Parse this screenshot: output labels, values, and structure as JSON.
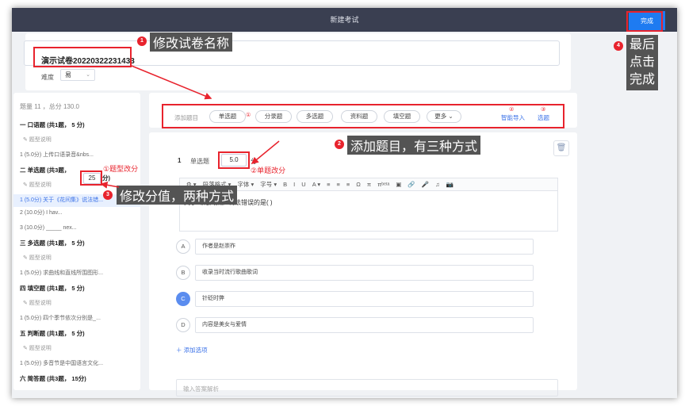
{
  "header": {
    "title": "新建考试",
    "done_label": "完成"
  },
  "paper": {
    "title": "演示试卷20220322231433",
    "difficulty_label": "难度",
    "difficulty_value": "易"
  },
  "sidebar": {
    "summary": "题量 11 ，总分 130.0",
    "rows": [
      {
        "type": "sec",
        "text": "一 口语题 (共1题，  5 分)"
      },
      {
        "type": "desc",
        "text": "✎ 题型说明"
      },
      {
        "type": "q",
        "text": "1 (5.0分) 上传口语录音&nbs..."
      },
      {
        "type": "sec",
        "text": "二 单选题 (共3题，"
      },
      {
        "type": "desc",
        "text": "✎ 题型说明"
      },
      {
        "type": "qa",
        "text": "1 (5.0分) 关于《花间集》说法错..."
      },
      {
        "type": "q",
        "text": "2 (10.0分) I hav..."
      },
      {
        "type": "q",
        "text": "3 (10.0分) _____ nex..."
      },
      {
        "type": "sec",
        "text": "三 多选题 (共1题，  5 分)"
      },
      {
        "type": "desc",
        "text": "✎ 题型说明"
      },
      {
        "type": "q",
        "text": "1 (5.0分) 求曲线和直线所围图形..."
      },
      {
        "type": "sec",
        "text": "四 填空题 (共1题，  5 分)"
      },
      {
        "type": "desc",
        "text": "✎ 题型说明"
      },
      {
        "type": "q",
        "text": "1 (5.0分) 四个季节依次分别是_..."
      },
      {
        "type": "sec",
        "text": "五 判断题 (共1题，  5 分)"
      },
      {
        "type": "desc",
        "text": "✎ 题型说明"
      },
      {
        "type": "q",
        "text": "1 (5.0分) 多音节是中国语言文化..."
      },
      {
        "type": "sec",
        "text": "六 简答题 (共3题， 15分)"
      }
    ],
    "section_score": "25",
    "section_suffix": "分)"
  },
  "addbar": {
    "label": "添加题目",
    "pills": [
      "单选题",
      "分录题",
      "多选题",
      "资料题",
      "填空题",
      "更多"
    ],
    "smart_import": "智能导入",
    "pick_question": "选题",
    "num1": "①",
    "num2": "②",
    "num3": "③"
  },
  "question": {
    "index": "1",
    "type": "单选题",
    "score": "5.0",
    "score_unit": "分",
    "toolbar": [
      "段落格式 ▾",
      "字体 ▾",
      "字号 ▾",
      "B",
      "I",
      "U",
      "A ▾",
      "≡",
      "≡",
      "≡",
      "Ω",
      "π",
      "πᵇᵉᵗᵃ",
      "▣",
      "🔗",
      "🎤",
      "♫",
      "📷"
    ],
    "stem": "关于《花间集》说法错误的是(    )",
    "options": [
      {
        "letter": "A",
        "text": "作者是赵崇祚"
      },
      {
        "letter": "B",
        "text": "收录当时流行歌曲歌词"
      },
      {
        "letter": "C",
        "text": "针砭时弊"
      },
      {
        "letter": "D",
        "text": "内容是美女与爱情"
      }
    ],
    "add_option": "添加选项",
    "analysis_placeholder": "输入答案解析"
  },
  "annotations": {
    "a1": "修改试卷名称",
    "a2": "添加题目，有三种方式",
    "a3": "修改分值，两种方式",
    "a4": "最后\n点击\n完成",
    "b1": "1",
    "b2": "2",
    "b3": "3",
    "b4": "4",
    "sub1": "①题型改分",
    "sub2": "②单题改分"
  }
}
